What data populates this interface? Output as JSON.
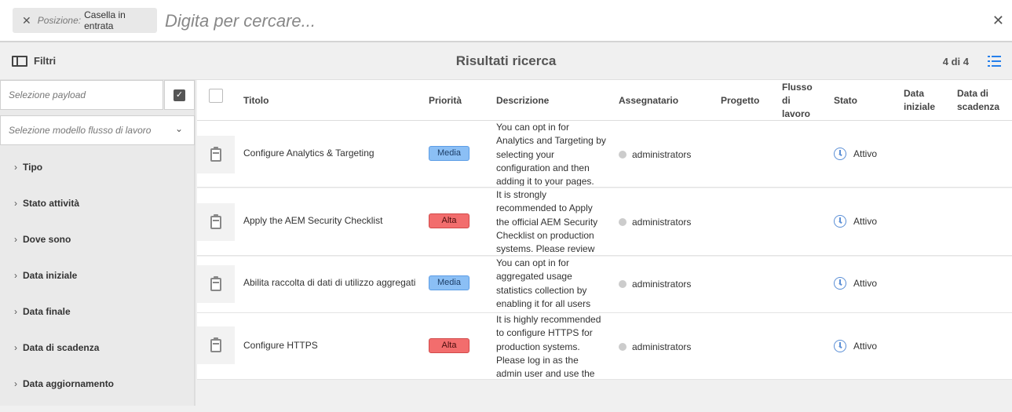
{
  "search": {
    "tag_key": "Posizione:",
    "tag_value": "Casella in entrata",
    "placeholder": "Digita per cercare..."
  },
  "actionbar": {
    "filters_label": "Filtri",
    "title": "Risultati ricerca",
    "count": "4 di 4"
  },
  "sidebar": {
    "payload_placeholder": "Selezione payload",
    "model_placeholder": "Selezione modello flusso di lavoro",
    "filters": [
      "Tipo",
      "Stato attività",
      "Dove sono",
      "Data iniziale",
      "Data finale",
      "Data di scadenza",
      "Data aggiornamento"
    ]
  },
  "table": {
    "headers": {
      "title": "Titolo",
      "priority": "Priorità",
      "description": "Descrizione",
      "assignee": "Assegnatario",
      "project": "Progetto",
      "workflow": "Flusso di lavoro",
      "status": "Stato",
      "start_date": "Data iniziale",
      "due_date": "Data di scadenza"
    },
    "rows": [
      {
        "title": "Configure Analytics & Targeting",
        "priority": "Media",
        "description": "You can opt in for Analytics and Targeting by selecting your configuration and then adding it to your pages.",
        "assignee": "administrators",
        "status": "Attivo"
      },
      {
        "title": "Apply the AEM Security Checklist",
        "priority": "Alta",
        "description": "It is strongly recommended to Apply the official AEM Security Checklist on production systems. Please review",
        "assignee": "administrators",
        "status": "Attivo"
      },
      {
        "title": "Abilita raccolta di dati di utilizzo aggregati",
        "priority": "Media",
        "description": "You can opt in for aggregated usage statistics collection by enabling it for all users",
        "assignee": "administrators",
        "status": "Attivo"
      },
      {
        "title": "Configure HTTPS",
        "priority": "Alta",
        "description": "It is highly recommended to configure HTTPS for production systems. Please log in as the admin user and use the SSL",
        "assignee": "administrators",
        "status": "Attivo"
      }
    ]
  },
  "colors": {
    "priority_media": "#8bbff5",
    "priority_alta": "#f26d6d",
    "accent": "#2680eb"
  },
  "icons": {
    "tag_close": "close-icon",
    "search_close": "close-icon",
    "filters": "sidebar-toggle-icon",
    "view": "list-view-icon",
    "row": "task-clipboard-icon",
    "status": "clock-icon",
    "accordion": "chevron-right-icon"
  }
}
